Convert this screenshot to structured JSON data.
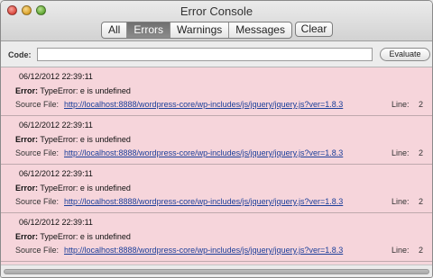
{
  "window": {
    "title": "Error Console"
  },
  "filters": {
    "all": "All",
    "errors": "Errors",
    "warnings": "Warnings",
    "messages": "Messages",
    "active": "Errors"
  },
  "clear_label": "Clear",
  "code_bar": {
    "label": "Code:",
    "value": "",
    "evaluate_label": "Evaluate"
  },
  "entries": [
    {
      "timestamp": "06/12/2012 22:39:11",
      "error_label": "Error:",
      "message": " TypeError: e is undefined",
      "source_label": "Source File:",
      "url": "http://localhost:8888/wordpress-core/wp-includes/js/jquery/jquery.js?ver=1.8.3",
      "line_label": "Line:",
      "line": "2"
    },
    {
      "timestamp": "06/12/2012 22:39:11",
      "error_label": "Error:",
      "message": " TypeError: e is undefined",
      "source_label": "Source File:",
      "url": "http://localhost:8888/wordpress-core/wp-includes/js/jquery/jquery.js?ver=1.8.3",
      "line_label": "Line:",
      "line": "2"
    },
    {
      "timestamp": "06/12/2012 22:39:11",
      "error_label": "Error:",
      "message": " TypeError: e is undefined",
      "source_label": "Source File:",
      "url": "http://localhost:8888/wordpress-core/wp-includes/js/jquery/jquery.js?ver=1.8.3",
      "line_label": "Line:",
      "line": "2"
    },
    {
      "timestamp": "06/12/2012 22:39:11",
      "error_label": "Error:",
      "message": " TypeError: e is undefined",
      "source_label": "Source File:",
      "url": "http://localhost:8888/wordpress-core/wp-includes/js/jquery/jquery.js?ver=1.8.3",
      "line_label": "Line:",
      "line": "2"
    }
  ],
  "colors": {
    "error_row": "#f6d5db",
    "link": "#1b3e9a",
    "active_segment": "#7a7a7a"
  }
}
